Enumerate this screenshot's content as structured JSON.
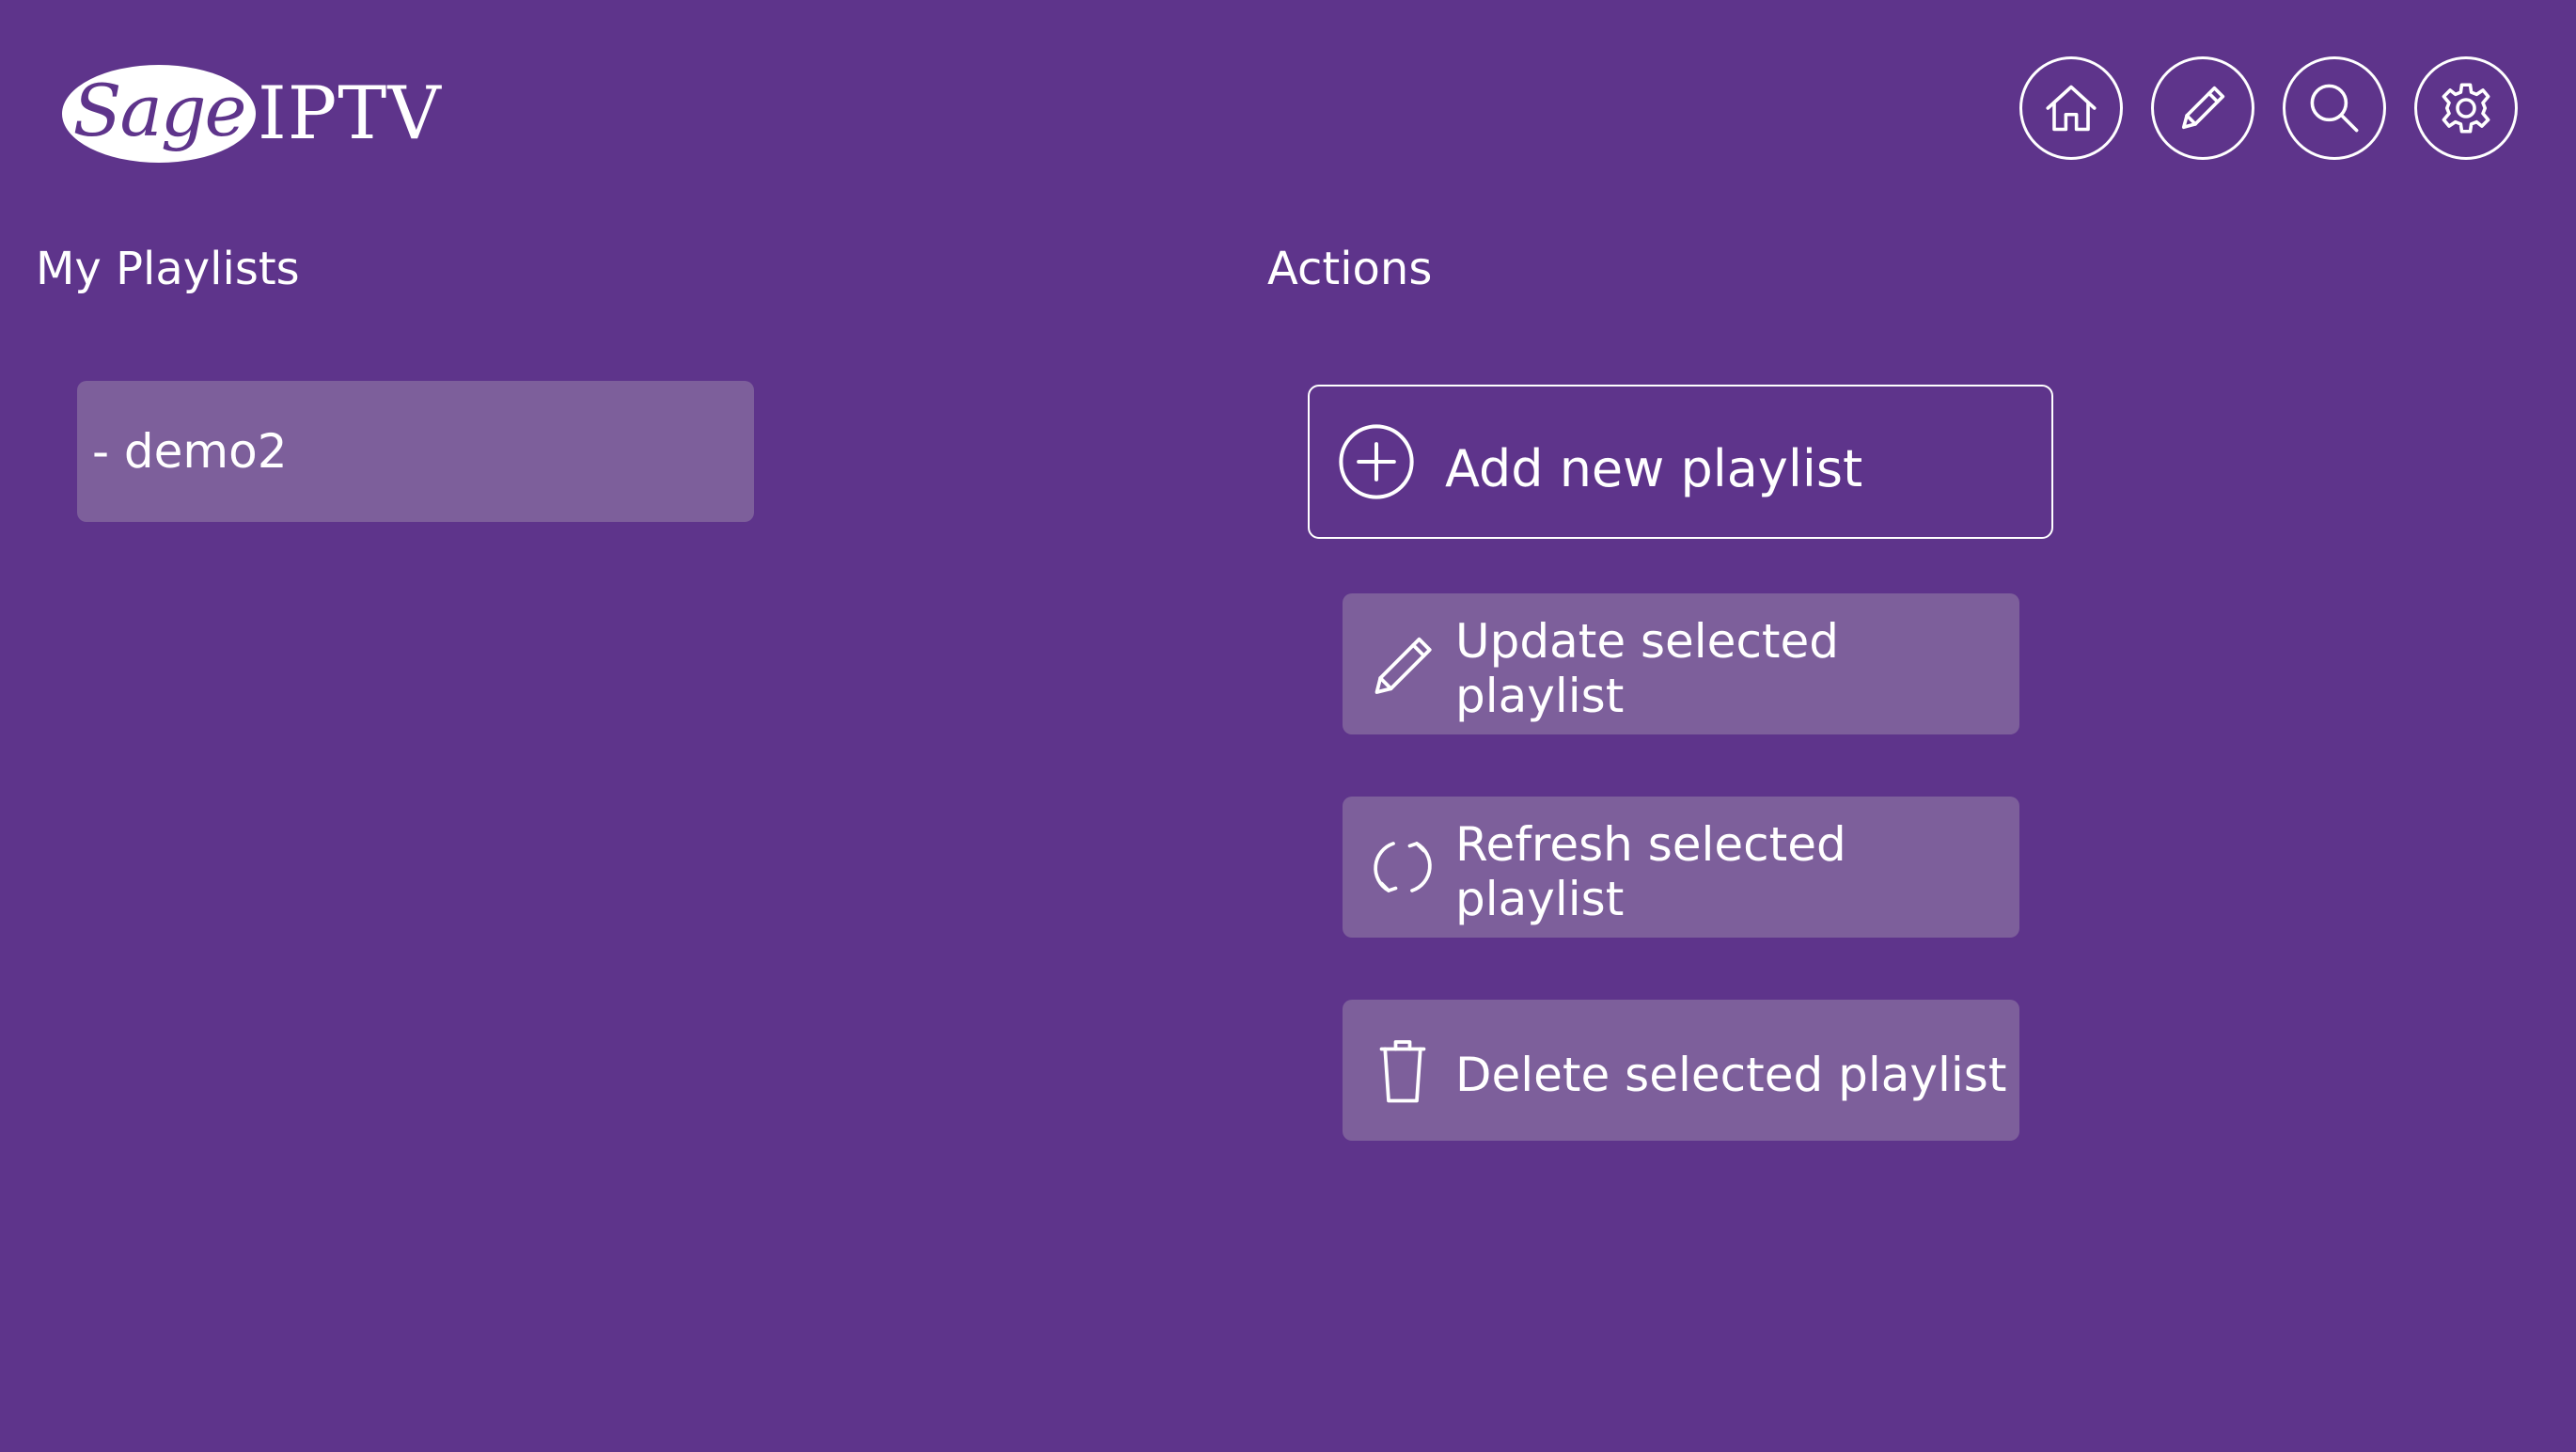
{
  "logo": {
    "oval_text": "Sage",
    "text": "IPTV"
  },
  "top_nav": [
    {
      "name": "home-icon",
      "icon": "home"
    },
    {
      "name": "pencil-icon",
      "icon": "pencil"
    },
    {
      "name": "search-icon",
      "icon": "search"
    },
    {
      "name": "gear-icon",
      "icon": "gear"
    }
  ],
  "playlists": {
    "title": "My Playlists",
    "items": [
      {
        "label": "- demo2"
      }
    ]
  },
  "actions": {
    "title": "Actions",
    "add_label": "Add new playlist",
    "add_icon": "plus-circle-icon",
    "update_label": "Update selected playlist",
    "update_icon": "pencil-icon",
    "refresh_label": "Refresh selected playlist",
    "refresh_icon": "refresh-icon",
    "delete_label": "Delete selected playlist",
    "delete_icon": "trash-icon"
  },
  "colors": {
    "background": "#5e348b",
    "button_fill": "#7d5f9b",
    "foreground": "#ffffff"
  }
}
